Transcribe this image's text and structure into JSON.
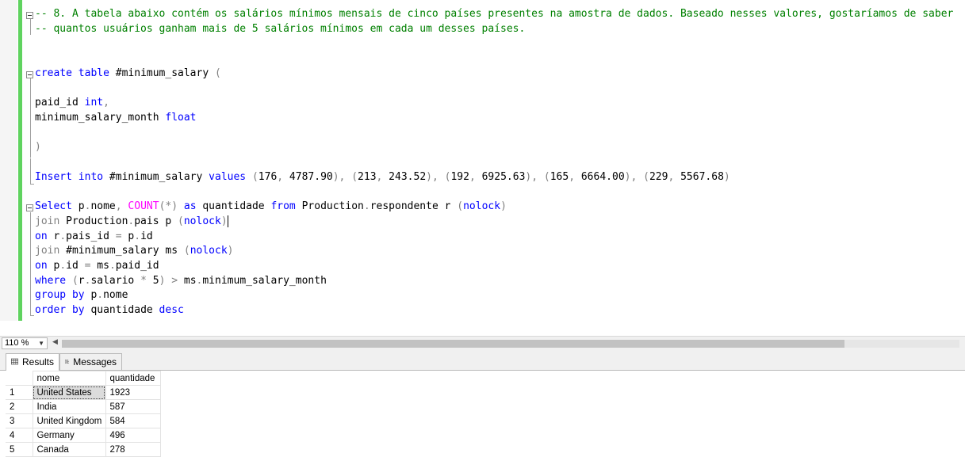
{
  "editor": {
    "lines": [
      {
        "parts": [
          {
            "t": "-- 8. A tabela abaixo contém os salários mínimos mensais de cinco países presentes na amostra de dados. Baseado nesses valores, gostaríamos de saber",
            "c": "cm"
          }
        ]
      },
      {
        "parts": [
          {
            "t": "-- quantos usuários ganham mais de 5 salários mínimos em cada um desses países.",
            "c": "cm"
          }
        ]
      },
      {
        "parts": []
      },
      {
        "parts": []
      },
      {
        "parts": [
          {
            "t": "create",
            "c": "kw"
          },
          {
            "t": " "
          },
          {
            "t": "table",
            "c": "kw"
          },
          {
            "t": " #minimum_salary "
          },
          {
            "t": "(",
            "c": "op"
          }
        ]
      },
      {
        "parts": []
      },
      {
        "parts": [
          {
            "t": "paid_id "
          },
          {
            "t": "int",
            "c": "kw"
          },
          {
            "t": ",",
            "c": "op"
          }
        ]
      },
      {
        "parts": [
          {
            "t": "minimum_salary_month "
          },
          {
            "t": "float",
            "c": "kw"
          }
        ]
      },
      {
        "parts": []
      },
      {
        "parts": [
          {
            "t": ")",
            "c": "op"
          }
        ]
      },
      {
        "parts": []
      },
      {
        "parts": [
          {
            "t": "Insert",
            "c": "kw"
          },
          {
            "t": " "
          },
          {
            "t": "into",
            "c": "kw"
          },
          {
            "t": " #minimum_salary "
          },
          {
            "t": "values",
            "c": "kw"
          },
          {
            "t": " "
          },
          {
            "t": "(",
            "c": "op"
          },
          {
            "t": "176"
          },
          {
            "t": ",",
            "c": "op"
          },
          {
            "t": " 4787.90"
          },
          {
            "t": "),",
            "c": "op"
          },
          {
            "t": " "
          },
          {
            "t": "(",
            "c": "op"
          },
          {
            "t": "213"
          },
          {
            "t": ",",
            "c": "op"
          },
          {
            "t": " 243.52"
          },
          {
            "t": "),",
            "c": "op"
          },
          {
            "t": " "
          },
          {
            "t": "(",
            "c": "op"
          },
          {
            "t": "192"
          },
          {
            "t": ",",
            "c": "op"
          },
          {
            "t": " 6925.63"
          },
          {
            "t": "),",
            "c": "op"
          },
          {
            "t": " "
          },
          {
            "t": "(",
            "c": "op"
          },
          {
            "t": "165"
          },
          {
            "t": ",",
            "c": "op"
          },
          {
            "t": " 6664.00"
          },
          {
            "t": "),",
            "c": "op"
          },
          {
            "t": " "
          },
          {
            "t": "(",
            "c": "op"
          },
          {
            "t": "229"
          },
          {
            "t": ",",
            "c": "op"
          },
          {
            "t": " 5567.68"
          },
          {
            "t": ")",
            "c": "op"
          }
        ]
      },
      {
        "parts": []
      },
      {
        "parts": [
          {
            "t": "Select",
            "c": "kw"
          },
          {
            "t": " p"
          },
          {
            "t": ".",
            "c": "op"
          },
          {
            "t": "nome"
          },
          {
            "t": ",",
            "c": "op"
          },
          {
            "t": " "
          },
          {
            "t": "COUNT",
            "c": "fn"
          },
          {
            "t": "(*)",
            "c": "op"
          },
          {
            "t": " "
          },
          {
            "t": "as",
            "c": "kw"
          },
          {
            "t": " quantidade "
          },
          {
            "t": "from",
            "c": "kw"
          },
          {
            "t": " Production"
          },
          {
            "t": ".",
            "c": "op"
          },
          {
            "t": "respondente r "
          },
          {
            "t": "(",
            "c": "op"
          },
          {
            "t": "nolock",
            "c": "kw"
          },
          {
            "t": ")",
            "c": "op"
          }
        ]
      },
      {
        "parts": [
          {
            "t": "join",
            "c": "op"
          },
          {
            "t": " Production"
          },
          {
            "t": ".",
            "c": "op"
          },
          {
            "t": "pais p "
          },
          {
            "t": "(",
            "c": "op"
          },
          {
            "t": "nolock",
            "c": "kw"
          },
          {
            "t": ")",
            "c": "op"
          }
        ],
        "caret": true
      },
      {
        "parts": [
          {
            "t": "on",
            "c": "kw"
          },
          {
            "t": " r"
          },
          {
            "t": ".",
            "c": "op"
          },
          {
            "t": "pais_id "
          },
          {
            "t": "=",
            "c": "op"
          },
          {
            "t": " p"
          },
          {
            "t": ".",
            "c": "op"
          },
          {
            "t": "id"
          }
        ]
      },
      {
        "parts": [
          {
            "t": "join",
            "c": "op"
          },
          {
            "t": " #minimum_salary ms "
          },
          {
            "t": "(",
            "c": "op"
          },
          {
            "t": "nolock",
            "c": "kw"
          },
          {
            "t": ")",
            "c": "op"
          }
        ]
      },
      {
        "parts": [
          {
            "t": "on",
            "c": "kw"
          },
          {
            "t": " p"
          },
          {
            "t": ".",
            "c": "op"
          },
          {
            "t": "id "
          },
          {
            "t": "=",
            "c": "op"
          },
          {
            "t": " ms"
          },
          {
            "t": ".",
            "c": "op"
          },
          {
            "t": "paid_id"
          }
        ]
      },
      {
        "parts": [
          {
            "t": "where",
            "c": "kw"
          },
          {
            "t": " "
          },
          {
            "t": "(",
            "c": "op"
          },
          {
            "t": "r"
          },
          {
            "t": ".",
            "c": "op"
          },
          {
            "t": "salario "
          },
          {
            "t": "*",
            "c": "op"
          },
          {
            "t": " 5"
          },
          {
            "t": ")",
            "c": "op"
          },
          {
            "t": " "
          },
          {
            "t": ">",
            "c": "op"
          },
          {
            "t": " ms"
          },
          {
            "t": ".",
            "c": "op"
          },
          {
            "t": "minimum_salary_month"
          }
        ]
      },
      {
        "parts": [
          {
            "t": "group",
            "c": "kw"
          },
          {
            "t": " "
          },
          {
            "t": "by",
            "c": "kw"
          },
          {
            "t": " p"
          },
          {
            "t": ".",
            "c": "op"
          },
          {
            "t": "nome"
          }
        ]
      },
      {
        "parts": [
          {
            "t": "order",
            "c": "kw"
          },
          {
            "t": " "
          },
          {
            "t": "by",
            "c": "kw"
          },
          {
            "t": " quantidade "
          },
          {
            "t": "desc",
            "c": "kw"
          }
        ]
      }
    ]
  },
  "zoom": {
    "value": "110 %"
  },
  "tabs": {
    "results": "Results",
    "messages": "Messages"
  },
  "grid": {
    "columns": [
      "nome",
      "quantidade"
    ],
    "rows": [
      {
        "num": "1",
        "nome": "United States",
        "quantidade": "1923"
      },
      {
        "num": "2",
        "nome": "India",
        "quantidade": "587"
      },
      {
        "num": "3",
        "nome": "United Kingdom",
        "quantidade": "584"
      },
      {
        "num": "4",
        "nome": "Germany",
        "quantidade": "496"
      },
      {
        "num": "5",
        "nome": "Canada",
        "quantidade": "278"
      }
    ]
  },
  "colors": {
    "keyword": "#0000ff",
    "comment": "#008000",
    "function": "#ff00ff",
    "operator": "#808080",
    "change_bar": "#5fd35f"
  }
}
